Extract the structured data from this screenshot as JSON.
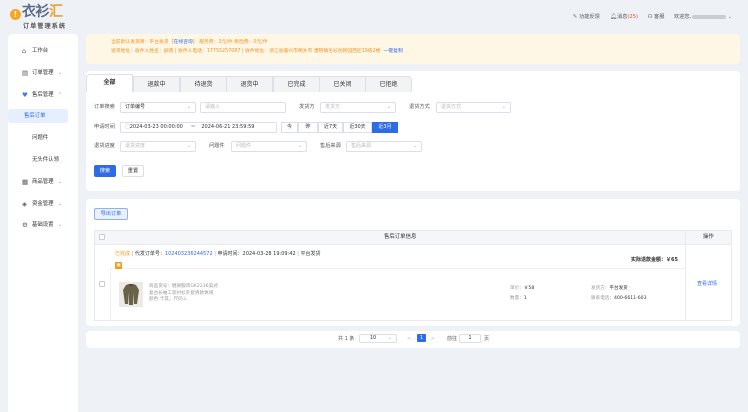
{
  "logo": {
    "main_1": "衣衫",
    "main_2": "汇",
    "subtitle": "订单管理系统"
  },
  "header": {
    "feedback": "功能反馈",
    "messages": "消息",
    "message_count": "(25)",
    "service": "客服",
    "welcome": "欢迎您,"
  },
  "sidebar": {
    "workbench": "工作台",
    "orders": "订单管理",
    "after_sales": "售后管理",
    "after_sales_orders": "售后订单",
    "problem_items": "问题件",
    "unowned_claim": "无头件认领",
    "products": "商品管理",
    "funds": "资金管理",
    "basic_settings": "基础设置"
  },
  "notice": {
    "line1_a": "当前默认发货商：",
    "line1_b": "平台发货",
    "line1_c": "[",
    "line1_link": "在线咨询",
    "line1_d": "]",
    "line1_e": "服务费：3元/件",
    "line1_f": "质检费：0元/件",
    "line2_a": "退货地址：收件人姓名：颜南",
    "line2_b": "收件人电话：17755257087",
    "line2_c": "收件地址：浙江省嘉兴市桐乡市 濮院镇毛衫创新园西区19栋2楼",
    "line2_link": "一键复制"
  },
  "tabs": [
    "全部",
    "退款中",
    "待退货",
    "退货中",
    "已完成",
    "已关闭",
    "已拒绝"
  ],
  "filters": {
    "order_search_label": "订单搜索",
    "order_search_select": "订单编号",
    "order_search_placeholder": "请输入",
    "sender_label": "发货方",
    "sender_placeholder": "发货方",
    "return_method_label": "退货方式",
    "return_method_placeholder": "退货方式",
    "apply_time_label": "申请时间",
    "start_date": "2024-03-23 00:00:00",
    "date_sep": "~",
    "end_date": "2024-06-21 23:59:59",
    "quick_ranges": [
      "今",
      "昨",
      "近7天",
      "近30天",
      "近3月"
    ],
    "return_progress_label": "退货进度",
    "return_progress_placeholder": "退货进度",
    "problem_label": "问题件",
    "problem_placeholder": "问题件",
    "source_label": "售后来源",
    "source_placeholder": "售后来源",
    "search_btn": "搜索",
    "reset_btn": "重置"
  },
  "table": {
    "export_btn": "导出订单",
    "col_info": "售后订单信息",
    "col_action": "操作",
    "rows": [
      {
        "status": "已完成",
        "order_label": "代发订单号：",
        "order_no": "102403236244572",
        "apply_label": "申请时间：",
        "apply_time": "2024-03-28 19:09:42",
        "shipper": "平台发货",
        "refund_label": "实际退款金额：",
        "refund": "￥65",
        "item_code": "商品货号：糖果服饰GK2236美式",
        "item_title": "复古长袖工装衬衫外套男款休闲",
        "item_spec": "颜色:卡其；尺码:L",
        "unit_price_label": "单价：",
        "unit_price": "￥58",
        "qty_label": "数量：",
        "qty": "1",
        "shipper2_label": "发货方：",
        "shipper2": "平台发货",
        "phone_label": "联系电话：",
        "phone": "400-6611-603",
        "action": "查看详情"
      }
    ]
  },
  "pager": {
    "total": "共 1 条",
    "page_size": "10",
    "prev": "<",
    "current": "1",
    "next": ">",
    "goto_label": "前往",
    "goto_value": "1",
    "page_unit": "页"
  },
  "colors": {
    "primary": "#2e6be6",
    "warning": "#f5a623",
    "background": "#eef1f6"
  }
}
